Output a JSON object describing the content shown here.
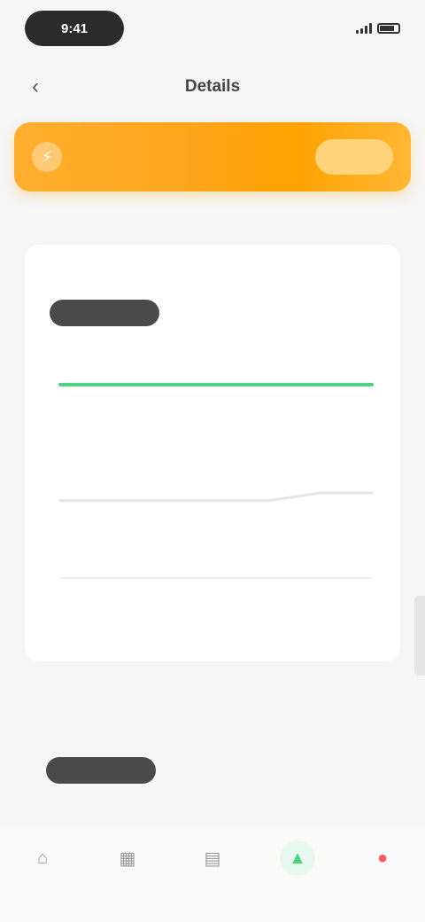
{
  "status_bar": {
    "time": "9:41"
  },
  "nav": {
    "back_icon": "chevron-left-icon",
    "title": "Details"
  },
  "banner": {
    "icon": "lightning-icon",
    "text": "",
    "button_label": ""
  },
  "subtabs": [
    "",
    ""
  ],
  "card": {
    "title": "",
    "segments": {
      "active": "",
      "items": [
        "",
        ""
      ]
    },
    "chart_data": {
      "type": "line",
      "series": [
        {
          "values": [
            100,
            100,
            100,
            100,
            100,
            100,
            100
          ],
          "color": "#4cd27e"
        },
        {
          "values": [
            40,
            40,
            40,
            40,
            40,
            44,
            44
          ],
          "color": "#e6e6e6"
        }
      ],
      "x": [
        "",
        "",
        "",
        "",
        "",
        "",
        ""
      ],
      "ylim": [
        0,
        110
      ],
      "grid": false
    }
  },
  "section2": {
    "title": "",
    "segments": {
      "active": "",
      "items": [
        "",
        ""
      ]
    }
  },
  "tabbar": {
    "items": [
      {
        "icon": "home-icon",
        "label": "",
        "color": "#b5b5b5"
      },
      {
        "icon": "grid-icon",
        "label": "",
        "color": "#b5b5b5"
      },
      {
        "icon": "calendar-icon",
        "label": "",
        "color": "#b5b5b5"
      },
      {
        "icon": "chart-icon",
        "label": "",
        "color": "#4cd27e"
      },
      {
        "icon": "profile-icon",
        "label": "",
        "color": "#ff5a6a"
      }
    ]
  }
}
